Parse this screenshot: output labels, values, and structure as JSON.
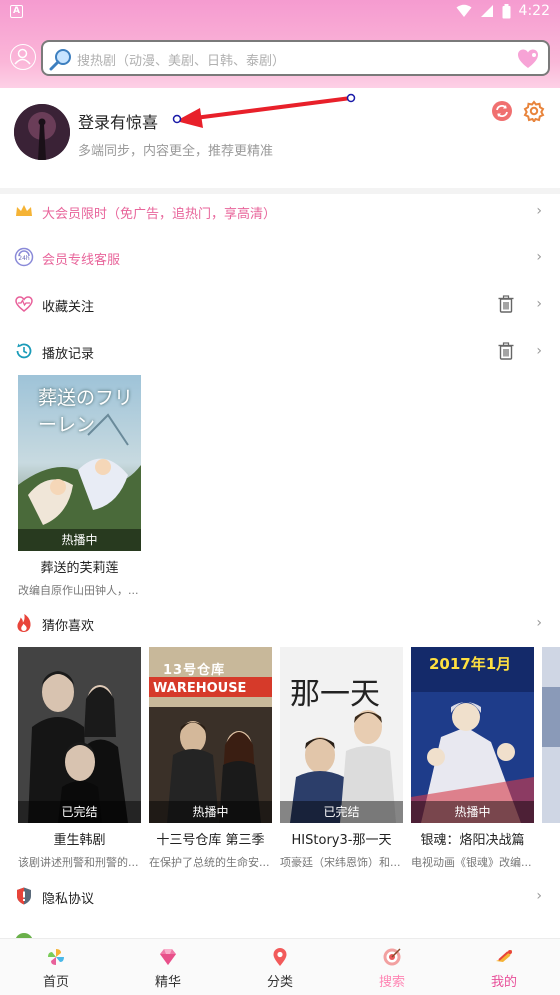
{
  "status_bar": {
    "time": "4:22",
    "app_badge": "A"
  },
  "search": {
    "placeholder": "搜热剧（动漫、美剧、日韩、泰剧）"
  },
  "profile": {
    "name": "登录有惊喜",
    "subtitle": "多端同步，内容更全，推荐更精准"
  },
  "menu": {
    "vip": "大会员限时（免广告，追热门，享高清）",
    "service": "会员专线客服",
    "favorites": "收藏关注",
    "history": "播放记录",
    "guess": "猜你喜欢",
    "privacy": "隐私协议"
  },
  "history_items": [
    {
      "title": "葬送的芙莉莲",
      "desc": "改编自原作山田钟人，...",
      "badge": "热播中",
      "poster_text": "葬送のフリーレン"
    }
  ],
  "guess_items": [
    {
      "title": "重生韩剧",
      "desc": "该剧讲述刑警和刑警的...",
      "badge": "已完结"
    },
    {
      "title": "十三号仓库 第三季",
      "desc": "在保护了总统的生命安...",
      "badge": "热播中",
      "poster_text": "13号仓库",
      "poster_sub": "WAREHOUSE"
    },
    {
      "title": "HIStory3-那一天",
      "desc": "项豪廷（宋纬恩饰）和...",
      "badge": "已完结",
      "poster_text": "那一天"
    },
    {
      "title": "银魂：烙阳决战篇",
      "desc": "电视动画《银魂》改编...",
      "badge": "热播中",
      "poster_text": "2017年1月"
    }
  ],
  "bottom_nav": [
    {
      "label": "首页"
    },
    {
      "label": "精华"
    },
    {
      "label": "分类"
    },
    {
      "label": "搜索"
    },
    {
      "label": "我的"
    }
  ],
  "colors": {
    "accent_pink": "#e8509a",
    "header_pink": "#f59bd0",
    "vip_text": "#e8659b"
  }
}
